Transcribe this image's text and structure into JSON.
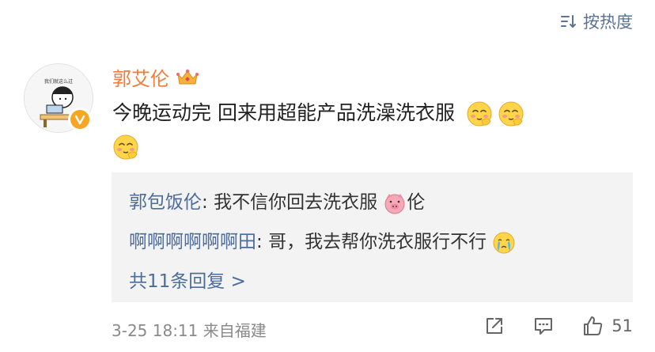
{
  "sort": {
    "label": "按热度"
  },
  "comment": {
    "username": "郭艾伦",
    "text": "今晚运动完 回来用超能产品洗澡洗衣服"
  },
  "avatar": {
    "caption": "我们就这么过"
  },
  "replies": [
    {
      "name": "郭包饭伦",
      "separator": ": ",
      "text": "我不信你回去洗衣服",
      "suffix": "伦"
    },
    {
      "name": "啊啊啊啊啊啊田",
      "separator": ": ",
      "text": "哥，我去帮你洗衣服行不行"
    }
  ],
  "more_replies": "共11条回复 >",
  "footer": {
    "date": "3-25 18:11",
    "source": "来自福建",
    "like_count": "51"
  },
  "colors": {
    "username": "#f07c3a",
    "link": "#4d6c9b",
    "reply_bg": "#f3f3f3",
    "meta": "#8a8a8a"
  },
  "icons": [
    "sort-icon",
    "crown-icon",
    "verified-icon",
    "blush-emoji-icon",
    "pig-emoji-icon",
    "crying-emoji-icon",
    "share-icon",
    "comment-icon",
    "like-icon"
  ]
}
